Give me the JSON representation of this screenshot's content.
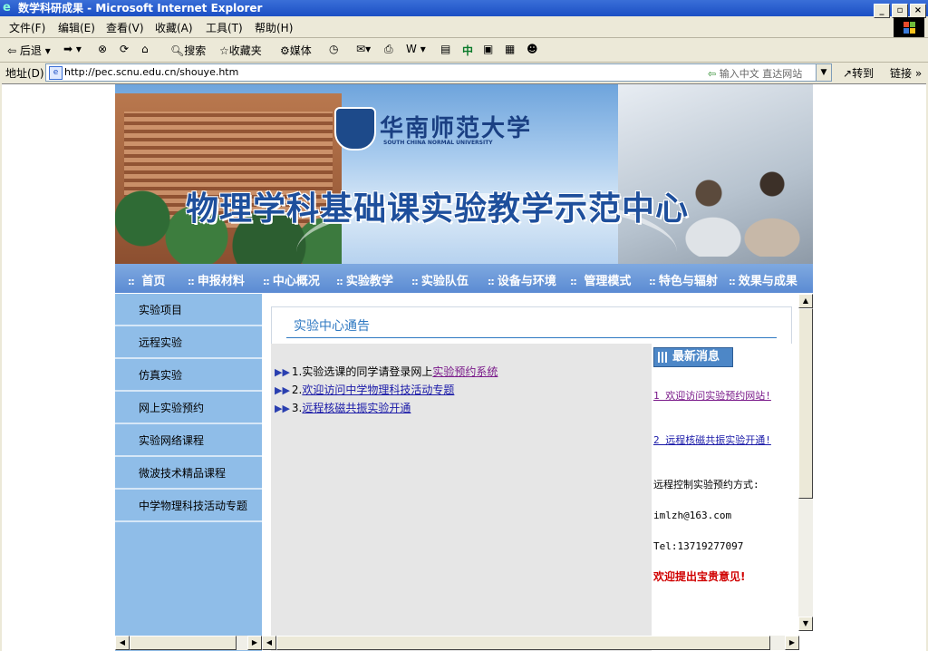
{
  "window": {
    "title": "数学科研成果 - Microsoft Internet Explorer"
  },
  "menu": [
    "文件(F)",
    "编辑(E)",
    "查看(V)",
    "收藏(A)",
    "工具(T)",
    "帮助(H)"
  ],
  "toolbar": {
    "back": "后退",
    "search": "搜索",
    "favorites": "收藏夹",
    "media": "媒体"
  },
  "address": {
    "label": "地址(D)",
    "url": "http://pec.scnu.edu.cn/shouye.htm",
    "hint": "输入中文 直达网站",
    "go": "转到",
    "links": "链接"
  },
  "banner": {
    "school_cn": "华南师范大学",
    "school_en": "SOUTH CHINA NORMAL UNIVERSITY",
    "title": "物理学科基础课实验教学示范中心"
  },
  "nav": [
    "首页",
    "申报材料",
    "中心概况",
    "实验教学",
    "实验队伍",
    "设备与环境",
    "管理模式",
    "特色与辐射",
    "效果与成果"
  ],
  "sidebar": [
    "实验项目",
    "远程实验",
    "仿真实验",
    "网上实验预约",
    "实验网络课程",
    "微波技术精品课程",
    "中学物理科技活动专题"
  ],
  "notice": {
    "title": "实验中心通告",
    "items": [
      {
        "prefix": "1.实验选课的同学请登录网上",
        "link": "实验预约系统"
      },
      {
        "prefix": "2.",
        "link": "欢迎访问中学物理科技活动专题"
      },
      {
        "prefix": "3.",
        "link": "远程核磁共振实验开通"
      }
    ]
  },
  "latest": {
    "badge": "最新消息",
    "link1": "1 欢迎访问实验预约网站!",
    "link2": "2 远程核磁共振实验开通!",
    "contact_label": "远程控制实验预约方式:",
    "email": "imlzh@163.com",
    "tel": "Tel:13719277097",
    "welcome": "欢迎提出宝贵意见!"
  }
}
